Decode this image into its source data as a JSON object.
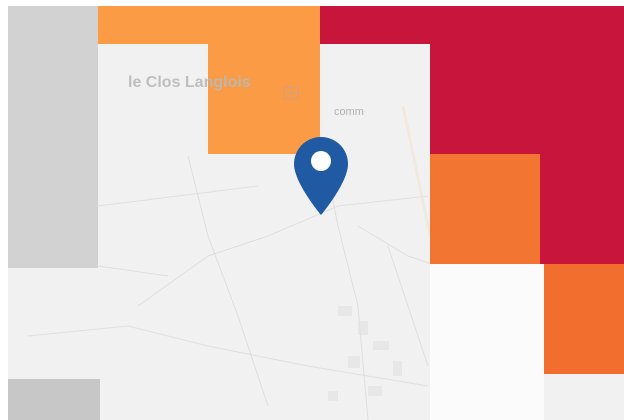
{
  "map": {
    "place_label": "le Clos Langlois",
    "secondary_label": "comm",
    "icons": {
      "marker": "location-pin-icon",
      "poi": "building-icon"
    },
    "colors": {
      "base": "#f1f1f1",
      "grey_light": "#d2d2d2",
      "grey_dark": "#c7c7c7",
      "white_area": "#fbfbfb",
      "light_orange": "#fb9b45",
      "orange": "#f27532",
      "orange_deep": "#f26e2f",
      "crimson": "#c7153c",
      "marker": "#1f5aa2"
    }
  }
}
